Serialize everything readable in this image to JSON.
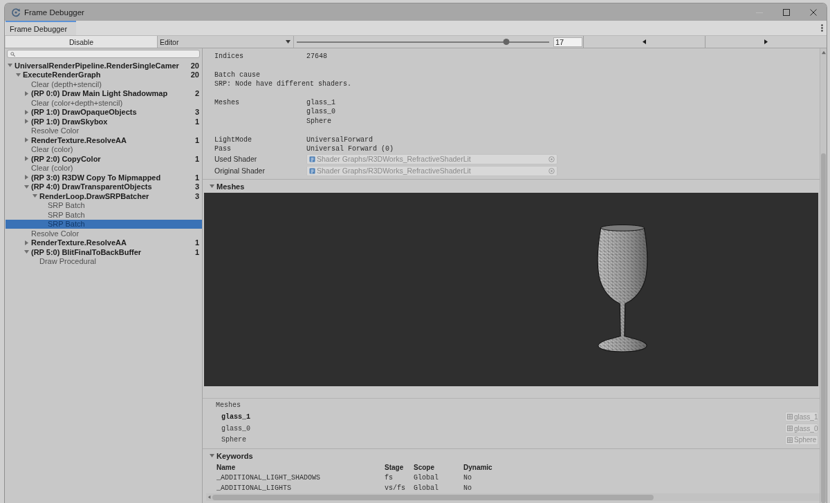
{
  "window": {
    "title": "Frame Debugger"
  },
  "tabs": [
    {
      "label": "Frame Debugger",
      "selected": true
    }
  ],
  "toolbar": {
    "disable_button": "Disable",
    "target_dropdown": "Editor",
    "slider": {
      "level": 0.83
    },
    "event_number": "17"
  },
  "tree": [
    {
      "kind": "group",
      "label": "UniversalRenderPipeline.RenderSingleCamer",
      "count": "20",
      "expanded": true,
      "selected": false,
      "children": [
        {
          "kind": "group",
          "label": "ExecuteRenderGraph",
          "count": "20",
          "expanded": true,
          "selected": false,
          "children": [
            {
              "kind": "event",
              "label": "Clear (depth+stencil)",
              "selected": false
            },
            {
              "kind": "group",
              "label": "(RP 0:0) Draw Main Light Shadowmap",
              "count": "2",
              "expanded": false,
              "selected": false
            },
            {
              "kind": "event",
              "label": "Clear (color+depth+stencil)",
              "selected": false
            },
            {
              "kind": "group",
              "label": "(RP 1:0) DrawOpaqueObjects",
              "count": "3",
              "expanded": false,
              "selected": false
            },
            {
              "kind": "group",
              "label": "(RP 1:0) DrawSkybox",
              "count": "1",
              "expanded": false,
              "selected": false
            },
            {
              "kind": "event",
              "label": "Resolve Color",
              "selected": false
            },
            {
              "kind": "group",
              "label": "RenderTexture.ResolveAA",
              "count": "1",
              "expanded": false,
              "selected": false
            },
            {
              "kind": "event",
              "label": "Clear (color)",
              "selected": false
            },
            {
              "kind": "group",
              "label": "(RP 2:0) CopyColor",
              "count": "1",
              "expanded": false,
              "selected": false
            },
            {
              "kind": "event",
              "label": "Clear (color)",
              "selected": false
            },
            {
              "kind": "group",
              "label": "(RP 3:0) R3DW Copy To Mipmapped",
              "count": "1",
              "expanded": false,
              "selected": false
            },
            {
              "kind": "group",
              "label": "(RP 4:0) DrawTransparentObjects",
              "count": "3",
              "expanded": true,
              "selected": false,
              "children": [
                {
                  "kind": "group",
                  "label": "RenderLoop.DrawSRPBatcher",
                  "count": "3",
                  "expanded": true,
                  "selected": false,
                  "children": [
                    {
                      "kind": "event",
                      "label": "SRP Batch",
                      "selected": false
                    },
                    {
                      "kind": "event",
                      "label": "SRP Batch",
                      "selected": false
                    },
                    {
                      "kind": "event",
                      "label": "SRP Batch",
                      "selected": true
                    }
                  ]
                }
              ]
            },
            {
              "kind": "event",
              "label": "Resolve Color",
              "selected": false
            },
            {
              "kind": "group",
              "label": "RenderTexture.ResolveAA",
              "count": "1",
              "expanded": false,
              "selected": false
            },
            {
              "kind": "group",
              "label": "(RP 5:0) BlitFinalToBackBuffer",
              "count": "1",
              "expanded": true,
              "selected": false,
              "children": [
                {
                  "kind": "event",
                  "label": "Draw Procedural",
                  "selected": false
                }
              ]
            }
          ]
        }
      ]
    }
  ],
  "details": {
    "sections": [
      [
        {
          "kind": "pair",
          "label": "Indices",
          "values": [
            "27648"
          ]
        }
      ],
      [
        {
          "kind": "stack",
          "label": "Batch cause",
          "values": [
            "SRP: Node have different shaders."
          ]
        }
      ],
      [
        {
          "kind": "pair",
          "label": "Meshes",
          "values": [
            "glass_1",
            "glass_0",
            "Sphere"
          ]
        }
      ],
      [
        {
          "kind": "pair",
          "label": "LightMode",
          "values": [
            "UniversalForward"
          ]
        },
        {
          "kind": "pair",
          "label": "Pass",
          "values": [
            "Universal Forward (0)"
          ]
        },
        {
          "kind": "shader",
          "label": "Used Shader",
          "values": [
            "Shader Graphs/R3DWorks_RefractiveShaderLit"
          ]
        },
        {
          "kind": "shader",
          "label": "Original Shader",
          "values": [
            "Shader Graphs/R3DWorks_RefractiveShaderLit"
          ]
        }
      ]
    ]
  },
  "preview": {
    "title": "Meshes",
    "expanded": true
  },
  "mesh_list": {
    "label": "Meshes",
    "items": [
      {
        "name": "glass_1",
        "asset": "glass_1",
        "selected": true
      },
      {
        "name": "glass_0",
        "asset": "glass_0",
        "selected": false
      },
      {
        "name": "Sphere",
        "asset": "Sphere",
        "selected": false
      }
    ]
  },
  "keywords": {
    "title": "Keywords",
    "expanded": true,
    "columns": [
      "Name",
      "Stage",
      "Scope",
      "Dynamic"
    ],
    "rows": [
      [
        "_ADDITIONAL_LIGHT_SHADOWS",
        "fs",
        "Global",
        "No"
      ],
      [
        "_ADDITIONAL_LIGHTS",
        "vs/fs",
        "Global",
        "No"
      ]
    ]
  }
}
